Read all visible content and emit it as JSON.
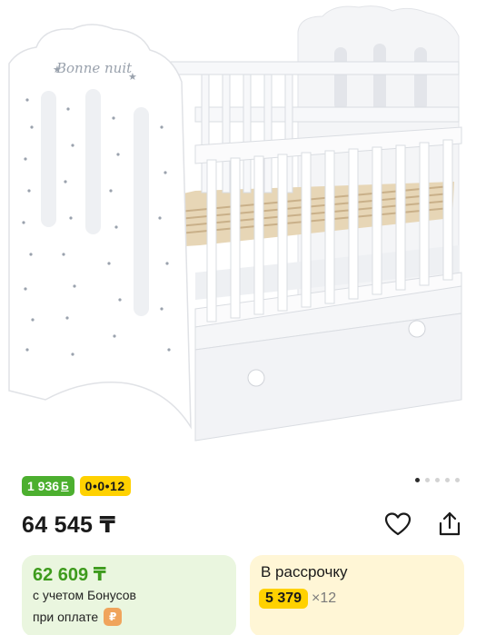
{
  "product": {
    "image_alt": "Bonne nuit",
    "carved_text": "Bonne nuit",
    "gallery": {
      "count": 5,
      "active": 0
    }
  },
  "badges": {
    "bonus": "1 936",
    "bonus_currency": "Б",
    "installment": "0•0•12"
  },
  "price": "64 545 ₸",
  "actions": {
    "favorite_icon": "heart-outline-icon",
    "share_icon": "share-upload-icon"
  },
  "bonus_card": {
    "price": "62 609 ₸",
    "note_line1": "с учетом Бонусов",
    "note_line2": "при оплате",
    "icon": "bonus-coin-icon"
  },
  "credit_card": {
    "title": "В рассрочку",
    "amount": "5 379",
    "times": "×12"
  },
  "colors": {
    "bonus_green": "#4caf2f",
    "plan_yellow": "#ffd100",
    "bonus_card_bg": "#eaf6df",
    "credit_card_bg": "#fff6d6",
    "bonus_price_green": "#3e9b1d"
  }
}
